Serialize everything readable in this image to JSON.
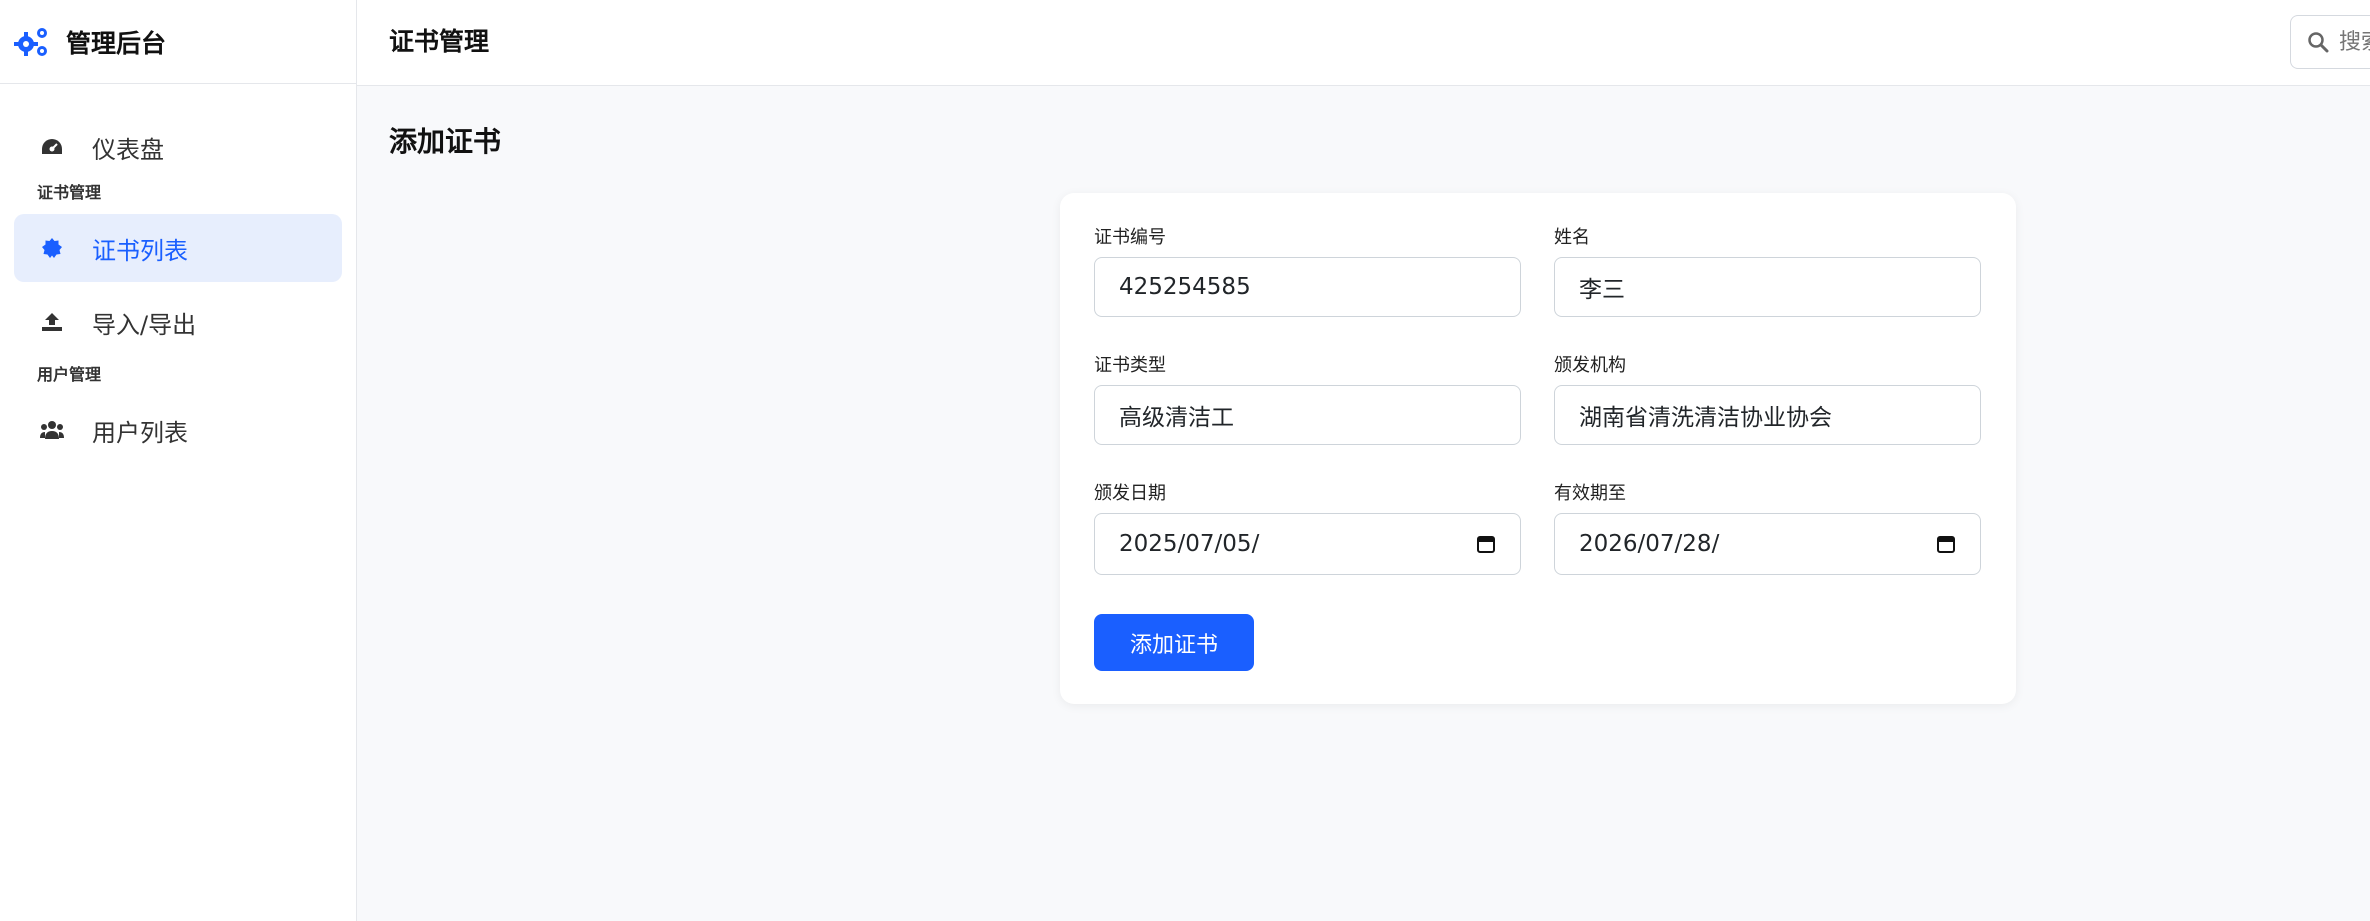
{
  "app": {
    "title": "管理后台"
  },
  "sidebar": {
    "dashboard": "仪表盘",
    "section_cert": "证书管理",
    "cert_list": "证书列表",
    "import_export": "导入/导出",
    "section_user": "用户管理",
    "user_list": "用户列表"
  },
  "header": {
    "title": "证书管理",
    "search_placeholder": "搜索"
  },
  "main": {
    "page_title": "添加证书",
    "form": {
      "cert_no_label": "证书编号",
      "cert_no_value": "425254585",
      "name_label": "姓名",
      "name_value": "李三",
      "cert_type_label": "证书类型",
      "cert_type_value": "高级清洁工",
      "issuer_label": "颁发机构",
      "issuer_value": "湖南省清洗清洁协业协会",
      "issue_date_label": "颁发日期",
      "issue_date_value": "2025/07/05/",
      "expiry_label": "有效期至",
      "expiry_value": "2026/07/28/",
      "submit_label": "添加证书"
    }
  },
  "colors": {
    "accent": "#1a5fff",
    "active_bg": "#e7eefd"
  }
}
